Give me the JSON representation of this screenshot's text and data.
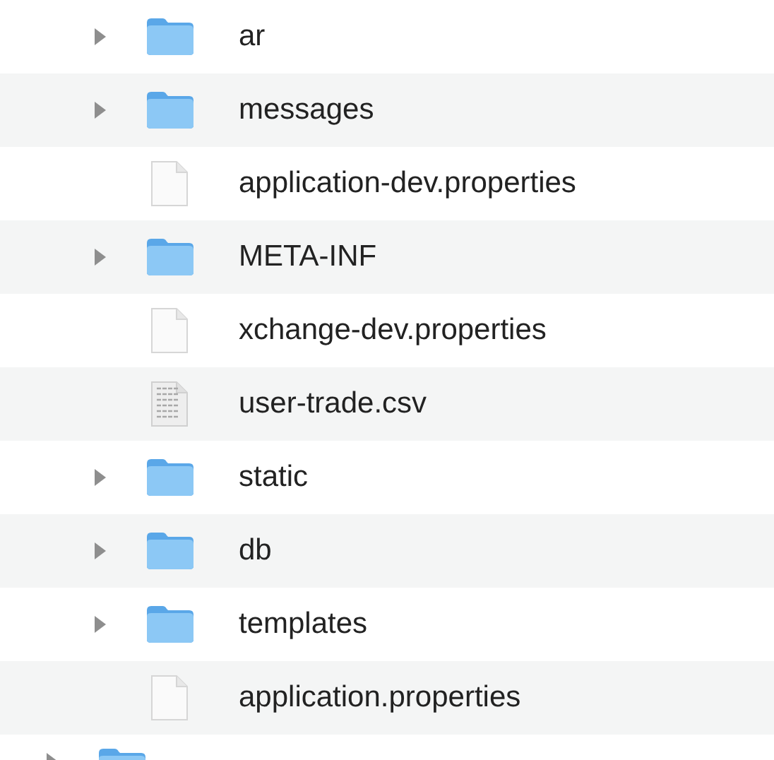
{
  "items": [
    {
      "kind": "folder",
      "name": "ar",
      "expanded": false
    },
    {
      "kind": "folder",
      "name": "messages",
      "expanded": false
    },
    {
      "kind": "file",
      "name": "application-dev.properties"
    },
    {
      "kind": "folder",
      "name": "META-INF",
      "expanded": false
    },
    {
      "kind": "file",
      "name": "xchange-dev.properties"
    },
    {
      "kind": "spreadsheet",
      "name": "user-trade.csv"
    },
    {
      "kind": "folder",
      "name": "static",
      "expanded": false
    },
    {
      "kind": "folder",
      "name": "db",
      "expanded": false
    },
    {
      "kind": "folder",
      "name": "templates",
      "expanded": false
    },
    {
      "kind": "file",
      "name": "application.properties"
    }
  ],
  "outer_items": [
    {
      "kind": "folder",
      "expanded": false
    }
  ]
}
